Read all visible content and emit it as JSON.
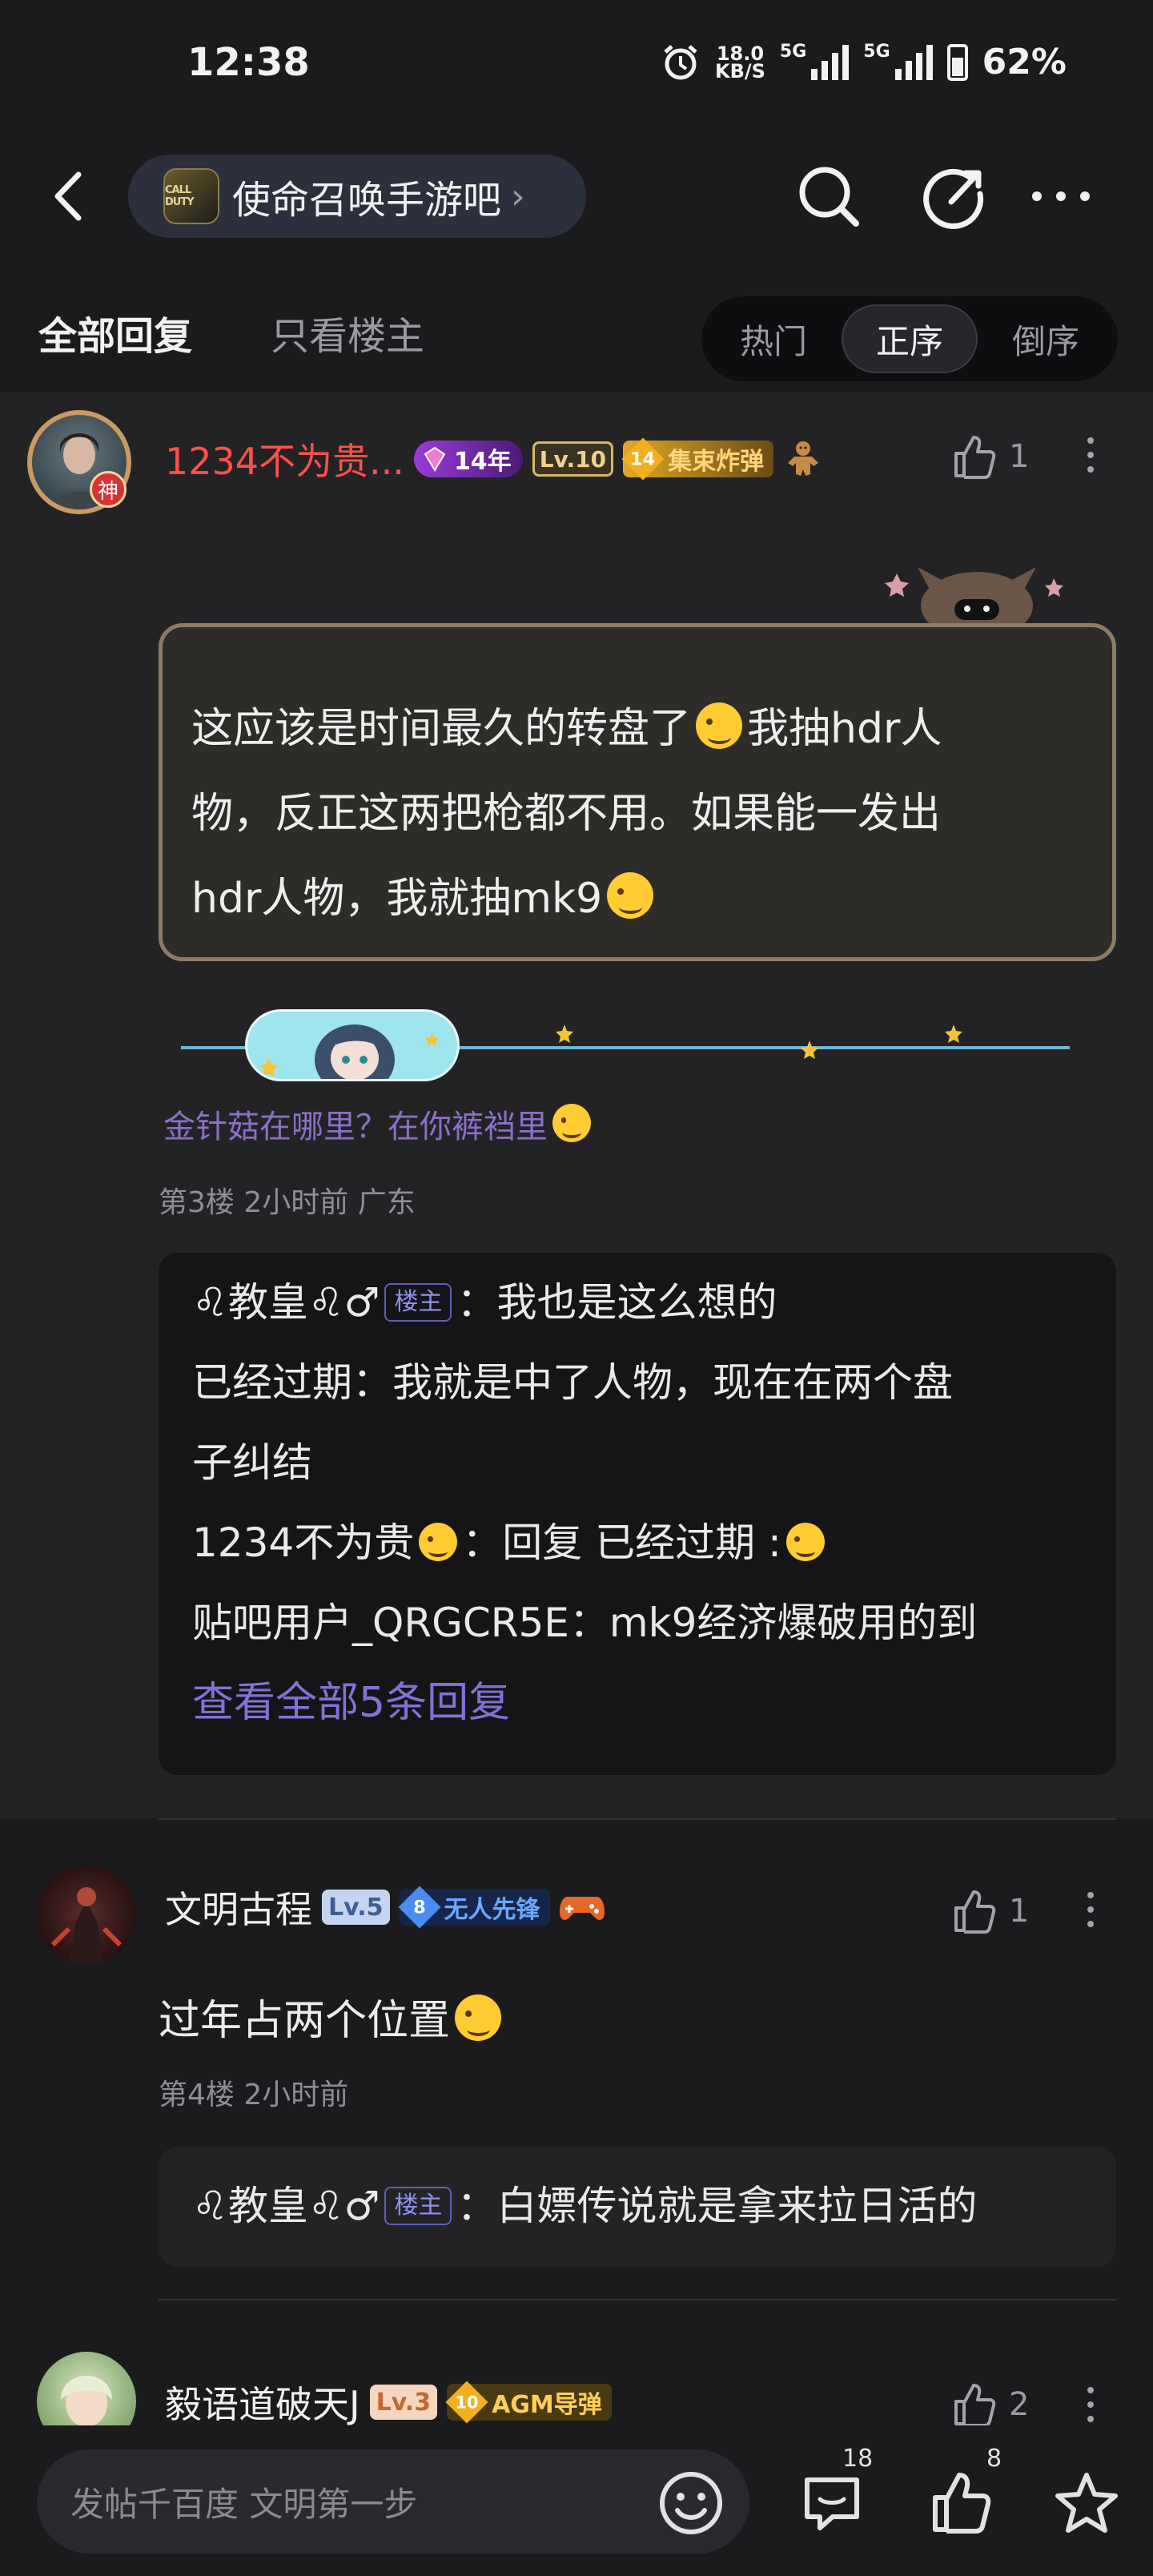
{
  "status": {
    "time": "12:38",
    "speed_value": "18.0",
    "speed_unit": "KB/S",
    "net1": "5G",
    "net2": "5G",
    "battery": "62%"
  },
  "nav": {
    "forum_name": "使命召唤手游吧",
    "forum_logo_text": "CALL DUTY"
  },
  "tabs": {
    "all": "全部回复",
    "host_only": "只看楼主",
    "sort": [
      "热门",
      "正序",
      "倒序"
    ],
    "active_sort": "正序"
  },
  "floor3": {
    "user": "1234不为贵...",
    "avatar_mark": "神",
    "badges": {
      "years": "14年",
      "level": "Lv.10",
      "medal_level": "14",
      "medal_name": "集束炸弹"
    },
    "likes": "1",
    "content_line1": "这应该是时间最久的转盘了",
    "content_line1b": "我抽hdr人",
    "content_line2": "物，反正这两把枪都不用。如果能一发出",
    "content_line3": "hdr人物，我就抽mk9",
    "signature": "金针菇在哪里？在你裤裆里",
    "meta": "第3楼  2小时前  广东",
    "replies": [
      {
        "user": "♌教皇♌♂",
        "is_host": true,
        "host_label": "楼主",
        "text": "：我也是这么想的"
      },
      {
        "user": "已经过期",
        "text": "：我就是中了人物，现在在两个盘"
      },
      {
        "user": "",
        "text": "子纠结"
      },
      {
        "user": "1234不为贵",
        "text": "：回复 已经过期 :"
      },
      {
        "user": "贴吧用户_QRGCR5E",
        "text": "：mk9经济爆破用的到"
      }
    ],
    "view_all": "查看全部5条回复"
  },
  "floor4": {
    "user": "文明古程",
    "level": "Lv.5",
    "medal_level": "8",
    "medal_name": "无人先锋",
    "likes": "1",
    "content": "过年占两个位置",
    "meta": "第4楼  2小时前",
    "reply": {
      "user": "♌教皇♌♂",
      "host_label": "楼主",
      "text": "：白嫖传说就是拿来拉日活的"
    }
  },
  "floor5": {
    "user": "毅语道破天J",
    "level": "Lv.3",
    "medal_level": "10",
    "medal_name": "AGM导弹",
    "likes": "2"
  },
  "bottom": {
    "placeholder": "发帖千百度 文明第一步",
    "comment_count": "18",
    "like_count": "8"
  }
}
